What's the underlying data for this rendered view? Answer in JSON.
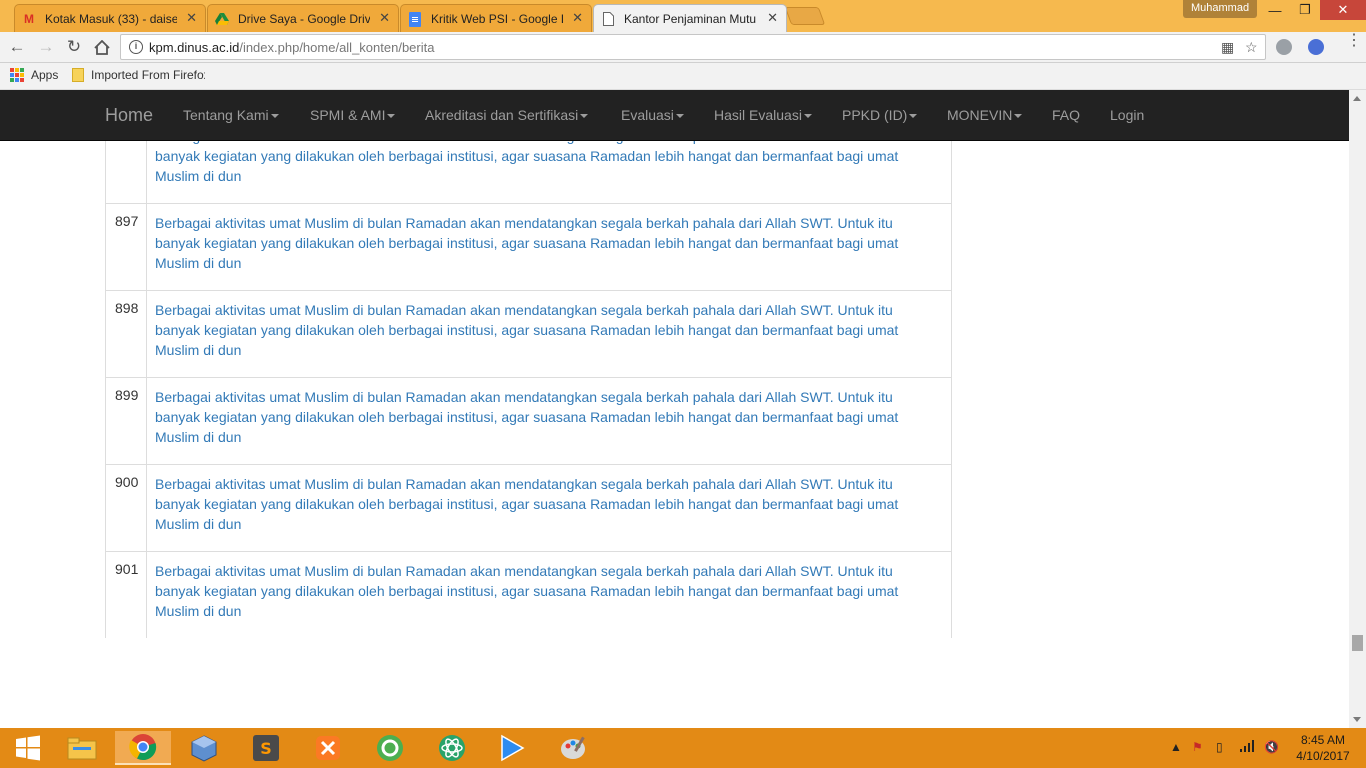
{
  "browser": {
    "tabs": [
      {
        "title": "Kotak Masuk (33) - daise",
        "icon": "gmail-icon"
      },
      {
        "title": "Drive Saya - Google Drive",
        "icon": "google-drive-icon"
      },
      {
        "title": "Kritik Web PSI - Google D",
        "icon": "google-docs-icon"
      },
      {
        "title": "Kantor Penjaminan Mutu",
        "icon": "page-icon",
        "active": true
      }
    ],
    "profile_name": "Muhammad",
    "url_host": "kpm.dinus.ac.id",
    "url_path": "/index.php/home/all_konten/berita",
    "bookmarks": {
      "apps_label": "Apps",
      "folder_label": "Imported From Firefox"
    }
  },
  "site": {
    "brand": "Home",
    "menu": [
      {
        "label": "Tentang Kami",
        "dropdown": true
      },
      {
        "label": "SPMI & AMI",
        "dropdown": true
      },
      {
        "label": "Akreditasi dan Sertifikasi",
        "dropdown": true
      },
      {
        "label": "Evaluasi",
        "dropdown": true
      },
      {
        "label": "Hasil Evaluasi",
        "dropdown": true
      },
      {
        "label": "PPKD (ID)",
        "dropdown": true
      },
      {
        "label": "MONEVIN",
        "dropdown": true
      },
      {
        "label": "FAQ",
        "dropdown": false
      },
      {
        "label": "Login",
        "dropdown": false
      }
    ]
  },
  "news_rows": [
    {
      "number": "",
      "text": "Berbagai aktivitas umat Muslim di bulan Ramadan akan mendatangkan segala berkah pahala dari Allah SWT. Untuk itu banyak kegiatan yang dilakukan oleh berbagai institusi, agar suasana Ramadan lebih hangat dan bermanfaat bagi umat Muslim di dun"
    },
    {
      "number": "896",
      "text": "Berbagai aktivitas umat Muslim di bulan Ramadan akan mendatangkan segala berkah pahala dari Allah SWT. Untuk itu banyak kegiatan yang dilakukan oleh berbagai institusi, agar suasana Ramadan lebih hangat dan bermanfaat bagi umat Muslim di dun"
    },
    {
      "number": "897",
      "text": "Berbagai aktivitas umat Muslim di bulan Ramadan akan mendatangkan segala berkah pahala dari Allah SWT. Untuk itu banyak kegiatan yang dilakukan oleh berbagai institusi, agar suasana Ramadan lebih hangat dan bermanfaat bagi umat Muslim di dun"
    },
    {
      "number": "898",
      "text": "Berbagai aktivitas umat Muslim di bulan Ramadan akan mendatangkan segala berkah pahala dari Allah SWT. Untuk itu banyak kegiatan yang dilakukan oleh berbagai institusi, agar suasana Ramadan lebih hangat dan bermanfaat bagi umat Muslim di dun"
    },
    {
      "number": "899",
      "text": "Berbagai aktivitas umat Muslim di bulan Ramadan akan mendatangkan segala berkah pahala dari Allah SWT. Untuk itu banyak kegiatan yang dilakukan oleh berbagai institusi, agar suasana Ramadan lebih hangat dan bermanfaat bagi umat Muslim di dun"
    },
    {
      "number": "900",
      "text": "Berbagai aktivitas umat Muslim di bulan Ramadan akan mendatangkan segala berkah pahala dari Allah SWT. Untuk itu banyak kegiatan yang dilakukan oleh berbagai institusi, agar suasana Ramadan lebih hangat dan bermanfaat bagi umat Muslim di dun"
    },
    {
      "number": "901",
      "text": "Berbagai aktivitas umat Muslim di bulan Ramadan akan mendatangkan segala berkah pahala dari Allah SWT. Untuk itu banyak kegiatan yang dilakukan oleh berbagai institusi, agar suasana Ramadan lebih hangat dan bermanfaat bagi umat Muslim di dun"
    }
  ],
  "taskbar": {
    "pinned": [
      "windows-start-icon",
      "file-explorer-icon",
      "chrome-icon",
      "virtualbox-icon",
      "sublime-text-icon",
      "xampp-icon",
      "camtasia-icon",
      "atom-icon",
      "media-player-icon",
      "paint-icon"
    ],
    "clock_time": "8:45 AM",
    "clock_date": "4/10/2017"
  },
  "colors": {
    "taskbar": "#e38a15",
    "tabstrip": "#f6b94e",
    "navbar": "#222222",
    "link": "#337ab7"
  }
}
